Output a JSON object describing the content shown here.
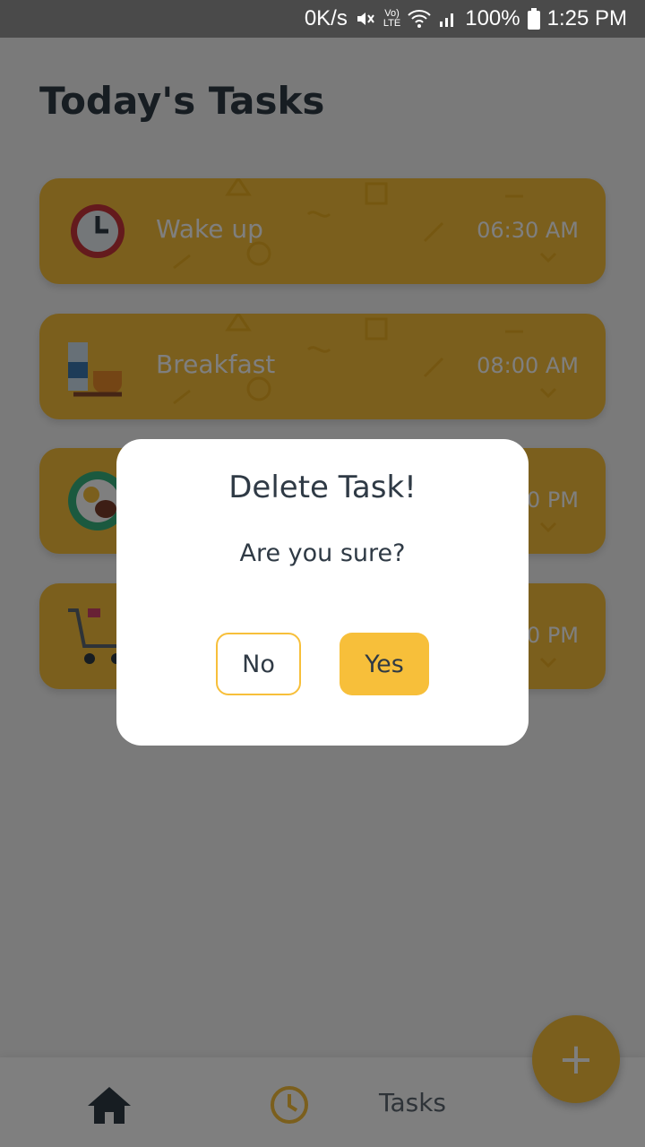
{
  "status_bar": {
    "speed": "0K/s",
    "lte": "LTE",
    "battery": "100%",
    "time": "1:25 PM"
  },
  "page": {
    "title": "Today's Tasks"
  },
  "tasks": [
    {
      "name": "Wake up",
      "time": "06:30 AM",
      "icon": "alarm-clock-icon"
    },
    {
      "name": "Breakfast",
      "time": "08:00 AM",
      "icon": "breakfast-icon"
    },
    {
      "name": "",
      "time": "0 PM",
      "icon": "lunch-plate-icon"
    },
    {
      "name": "",
      "time": "0 PM",
      "icon": "shopping-cart-icon"
    }
  ],
  "dialog": {
    "title": "Delete Task!",
    "message": "Are you sure?",
    "no_label": "No",
    "yes_label": "Yes"
  },
  "bottom_nav": {
    "tasks_label": "Tasks",
    "fab_label": "+"
  },
  "colors": {
    "accent": "#f7bf3a",
    "text": "#2f3a45",
    "overlay": "rgba(0,0,0,0.5)"
  }
}
